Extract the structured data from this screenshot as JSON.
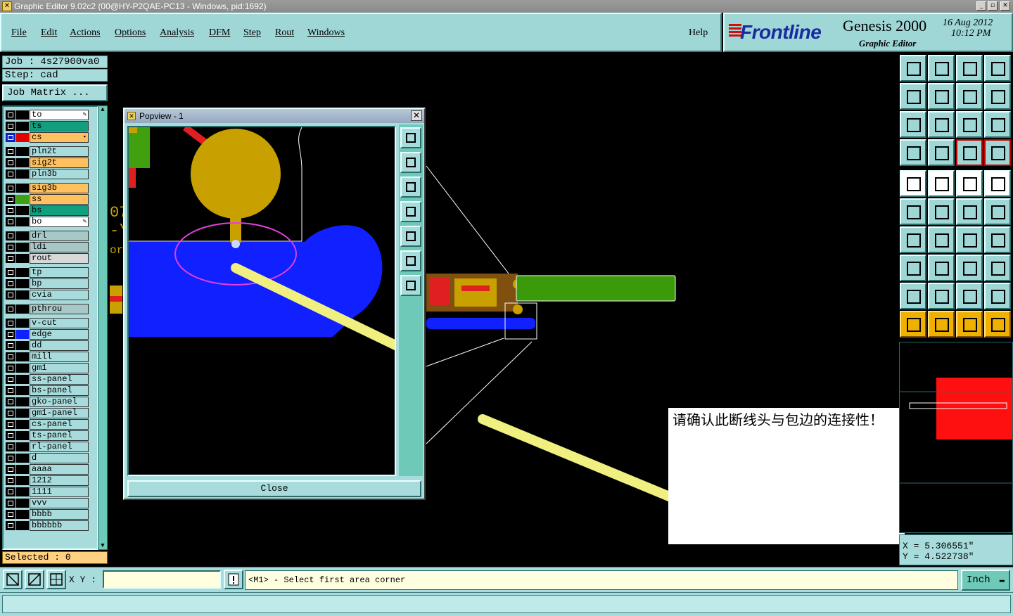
{
  "window": {
    "title": "Graphic Editor 9.02c2 (00@HY-P2QAE-PC13 - Windows, pid:1692)"
  },
  "menu": [
    "File",
    "Edit",
    "Actions",
    "Options",
    "Analysis",
    "DFM",
    "Step",
    "Rout",
    "Windows"
  ],
  "help_label": "Help",
  "brand": {
    "logo": "Frontline",
    "product": "Genesis 2000",
    "subtitle": "Graphic Editor",
    "date": "16 Aug 2012",
    "time": "10:12 PM"
  },
  "job": {
    "job_line": "Job : 4s27900va0",
    "step_line": "Step: cad",
    "matrix_button": "Job Matrix ..."
  },
  "layers": [
    {
      "name": "to",
      "bg": "#ffffff",
      "swatch": "#000000",
      "mark": "pen"
    },
    {
      "name": "ts",
      "bg": "#10a080",
      "swatch": "#000000",
      "mark": ""
    },
    {
      "name": "cs",
      "bg": "#ffc060",
      "swatch": "#e00000",
      "mark": "box",
      "active": true
    },
    {
      "name": "pln2t",
      "bg": "#a8dcdc",
      "swatch": "#000000",
      "mark": ""
    },
    {
      "name": "sig2t",
      "bg": "#ffc060",
      "swatch": "#000000",
      "mark": ""
    },
    {
      "name": "pln3b",
      "bg": "#a8dcdc",
      "swatch": "#000000",
      "mark": ""
    },
    {
      "name": "sig3b",
      "bg": "#ffc060",
      "swatch": "#000000",
      "mark": ""
    },
    {
      "name": "ss",
      "bg": "#ffc060",
      "swatch": "#40a010",
      "mark": ""
    },
    {
      "name": "bs",
      "bg": "#10a080",
      "swatch": "#000000",
      "mark": ""
    },
    {
      "name": "bo",
      "bg": "#ffffff",
      "swatch": "#000000",
      "mark": "pen"
    },
    {
      "name": "drl",
      "bg": "#a8c8c8",
      "swatch": "#000000",
      "mark": ""
    },
    {
      "name": "ldi",
      "bg": "#a8c8c8",
      "swatch": "#000000",
      "mark": ""
    },
    {
      "name": "rout",
      "bg": "#d8d8d8",
      "swatch": "#000000",
      "mark": ""
    },
    {
      "name": "tp",
      "bg": "#a8dcdc",
      "swatch": "#000000",
      "mark": ""
    },
    {
      "name": "bp",
      "bg": "#a8dcdc",
      "swatch": "#000000",
      "mark": ""
    },
    {
      "name": "cvia",
      "bg": "#a8dcdc",
      "swatch": "#000000",
      "mark": ""
    },
    {
      "name": "pthrou",
      "bg": "#a8c8c8",
      "swatch": "#000000",
      "mark": ""
    },
    {
      "name": "v-cut",
      "bg": "#a8dcdc",
      "swatch": "#000000",
      "mark": ""
    },
    {
      "name": "edge",
      "bg": "#a8dcdc",
      "swatch": "#1020ff",
      "mark": ""
    },
    {
      "name": "dd",
      "bg": "#a8dcdc",
      "swatch": "#000000",
      "mark": ""
    },
    {
      "name": "mill",
      "bg": "#a8dcdc",
      "swatch": "#000000",
      "mark": ""
    },
    {
      "name": "gm1",
      "bg": "#a8dcdc",
      "swatch": "#000000",
      "mark": ""
    },
    {
      "name": "ss-panel",
      "bg": "#a8dcdc",
      "swatch": "#000000",
      "mark": ""
    },
    {
      "name": "bs-panel",
      "bg": "#a8dcdc",
      "swatch": "#000000",
      "mark": ""
    },
    {
      "name": "gko-panel",
      "bg": "#a8dcdc",
      "swatch": "#000000",
      "mark": ""
    },
    {
      "name": "gm1-panel",
      "bg": "#a8dcdc",
      "swatch": "#000000",
      "mark": ""
    },
    {
      "name": "cs-panel",
      "bg": "#a8dcdc",
      "swatch": "#000000",
      "mark": ""
    },
    {
      "name": "ts-panel",
      "bg": "#a8dcdc",
      "swatch": "#000000",
      "mark": ""
    },
    {
      "name": "rl-panel",
      "bg": "#a8dcdc",
      "swatch": "#000000",
      "mark": ""
    },
    {
      "name": "d",
      "bg": "#a8dcdc",
      "swatch": "#000000",
      "mark": ""
    },
    {
      "name": "aaaa",
      "bg": "#a8dcdc",
      "swatch": "#000000",
      "mark": ""
    },
    {
      "name": "1212",
      "bg": "#a8dcdc",
      "swatch": "#000000",
      "mark": ""
    },
    {
      "name": "1111",
      "bg": "#a8dcdc",
      "swatch": "#000000",
      "mark": ""
    },
    {
      "name": "vvv",
      "bg": "#a8dcdc",
      "swatch": "#000000",
      "mark": ""
    },
    {
      "name": "bbbb",
      "bg": "#a8dcdc",
      "swatch": "#000000",
      "mark": ""
    },
    {
      "name": "bbbbbb",
      "bg": "#a8dcdc",
      "swatch": "#000000",
      "mark": ""
    }
  ],
  "selected": "Selected : 0",
  "popview": {
    "title": "Popview - 1",
    "close_label": "Close"
  },
  "annotation": "请确认此断线头与包边的连接性！",
  "coords": {
    "x": "X  =  5.306551\"",
    "y": "Y  =  4.522738\""
  },
  "status": {
    "xy_label": "X Y :",
    "xy_value": "",
    "message": "<M1> - Select first area corner",
    "unit": "Inch"
  },
  "colors": {
    "panel": "#a8dcdc",
    "accent": "#9fd6d6",
    "copper": "#c8a000",
    "trace": "#f0f080",
    "edge": "#1020ff"
  }
}
